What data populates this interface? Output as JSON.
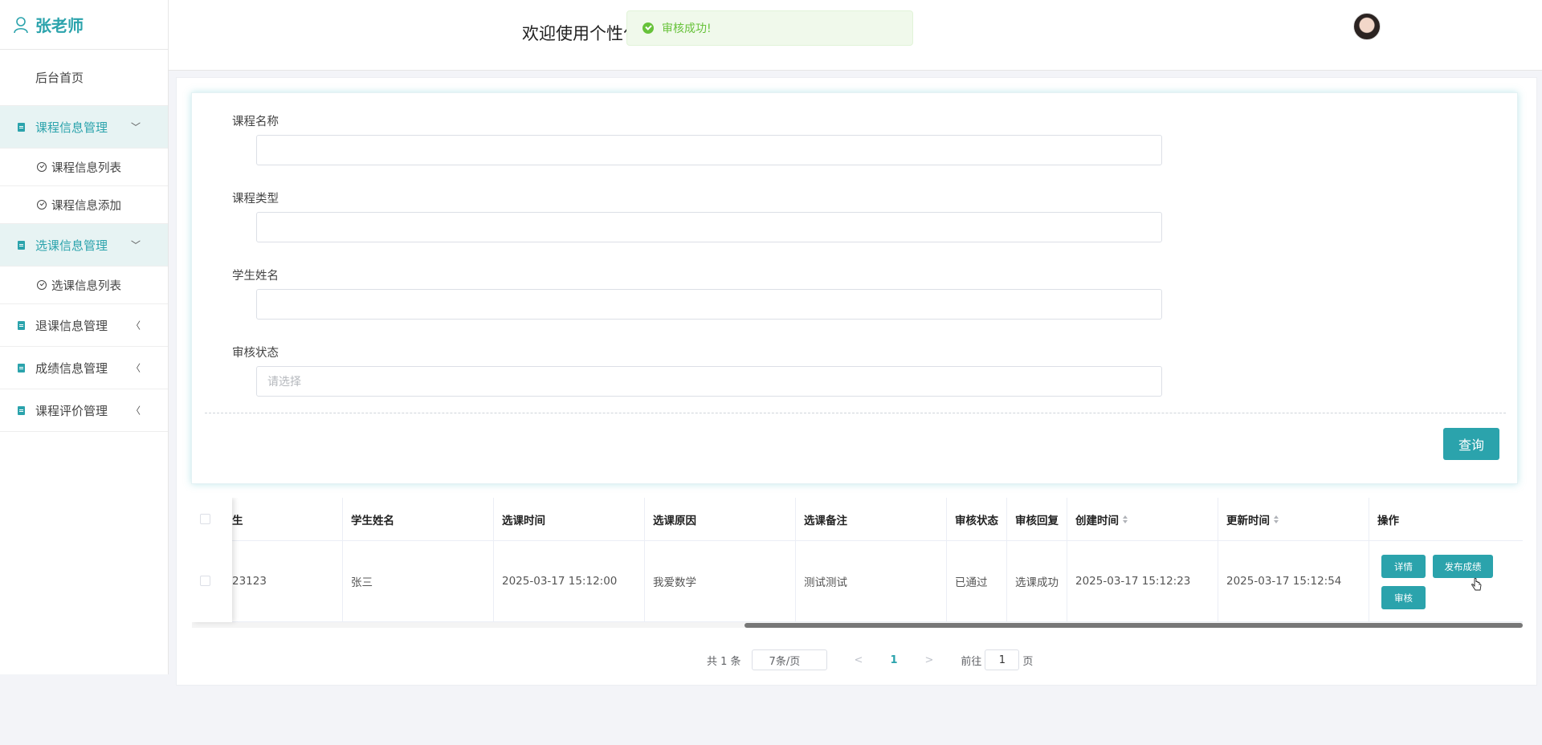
{
  "sidebar": {
    "username": "张老师",
    "home": "后台首页",
    "groups": [
      {
        "label": "课程信息管理",
        "expanded": true,
        "children": [
          "课程信息列表",
          "课程信息添加"
        ]
      },
      {
        "label": "选课信息管理",
        "expanded": true,
        "children": [
          "选课信息列表"
        ]
      },
      {
        "label": "退课信息管理",
        "expanded": false,
        "children": []
      },
      {
        "label": "成绩信息管理",
        "expanded": false,
        "children": []
      },
      {
        "label": "课程评价管理",
        "expanded": false,
        "children": []
      }
    ]
  },
  "header": {
    "welcome": "欢迎使用个性化"
  },
  "toast": {
    "message": "审核成功!"
  },
  "search": {
    "fields": [
      {
        "label": "课程名称",
        "value": "",
        "placeholder": ""
      },
      {
        "label": "课程类型",
        "value": "",
        "placeholder": ""
      },
      {
        "label": "学生姓名",
        "value": "",
        "placeholder": ""
      },
      {
        "label": "审核状态",
        "value": "",
        "placeholder": "请选择"
      }
    ],
    "query_label": "查询"
  },
  "table": {
    "columns": [
      "生",
      "学生姓名",
      "选课时间",
      "选课原因",
      "选课备注",
      "审核状态",
      "审核回复",
      "创建时间",
      "更新时间",
      "操作"
    ],
    "rows": [
      {
        "cells": [
          "23123",
          "张三",
          "2025-03-17 15:12:00",
          "我爱数学",
          "测试测试",
          "已通过",
          "选课成功",
          "2025-03-17 15:12:23",
          "2025-03-17 15:12:54"
        ],
        "actions": [
          "详情",
          "发布成绩",
          "审核"
        ]
      }
    ]
  },
  "pagination": {
    "total_text": "共 1 条",
    "page_size": "7条/页",
    "current_page": "1",
    "goto_label": "前往",
    "goto_value": "1",
    "page_suffix": "页"
  },
  "colors": {
    "accent": "#2ba3ac",
    "toast_green": "#67c23a"
  }
}
